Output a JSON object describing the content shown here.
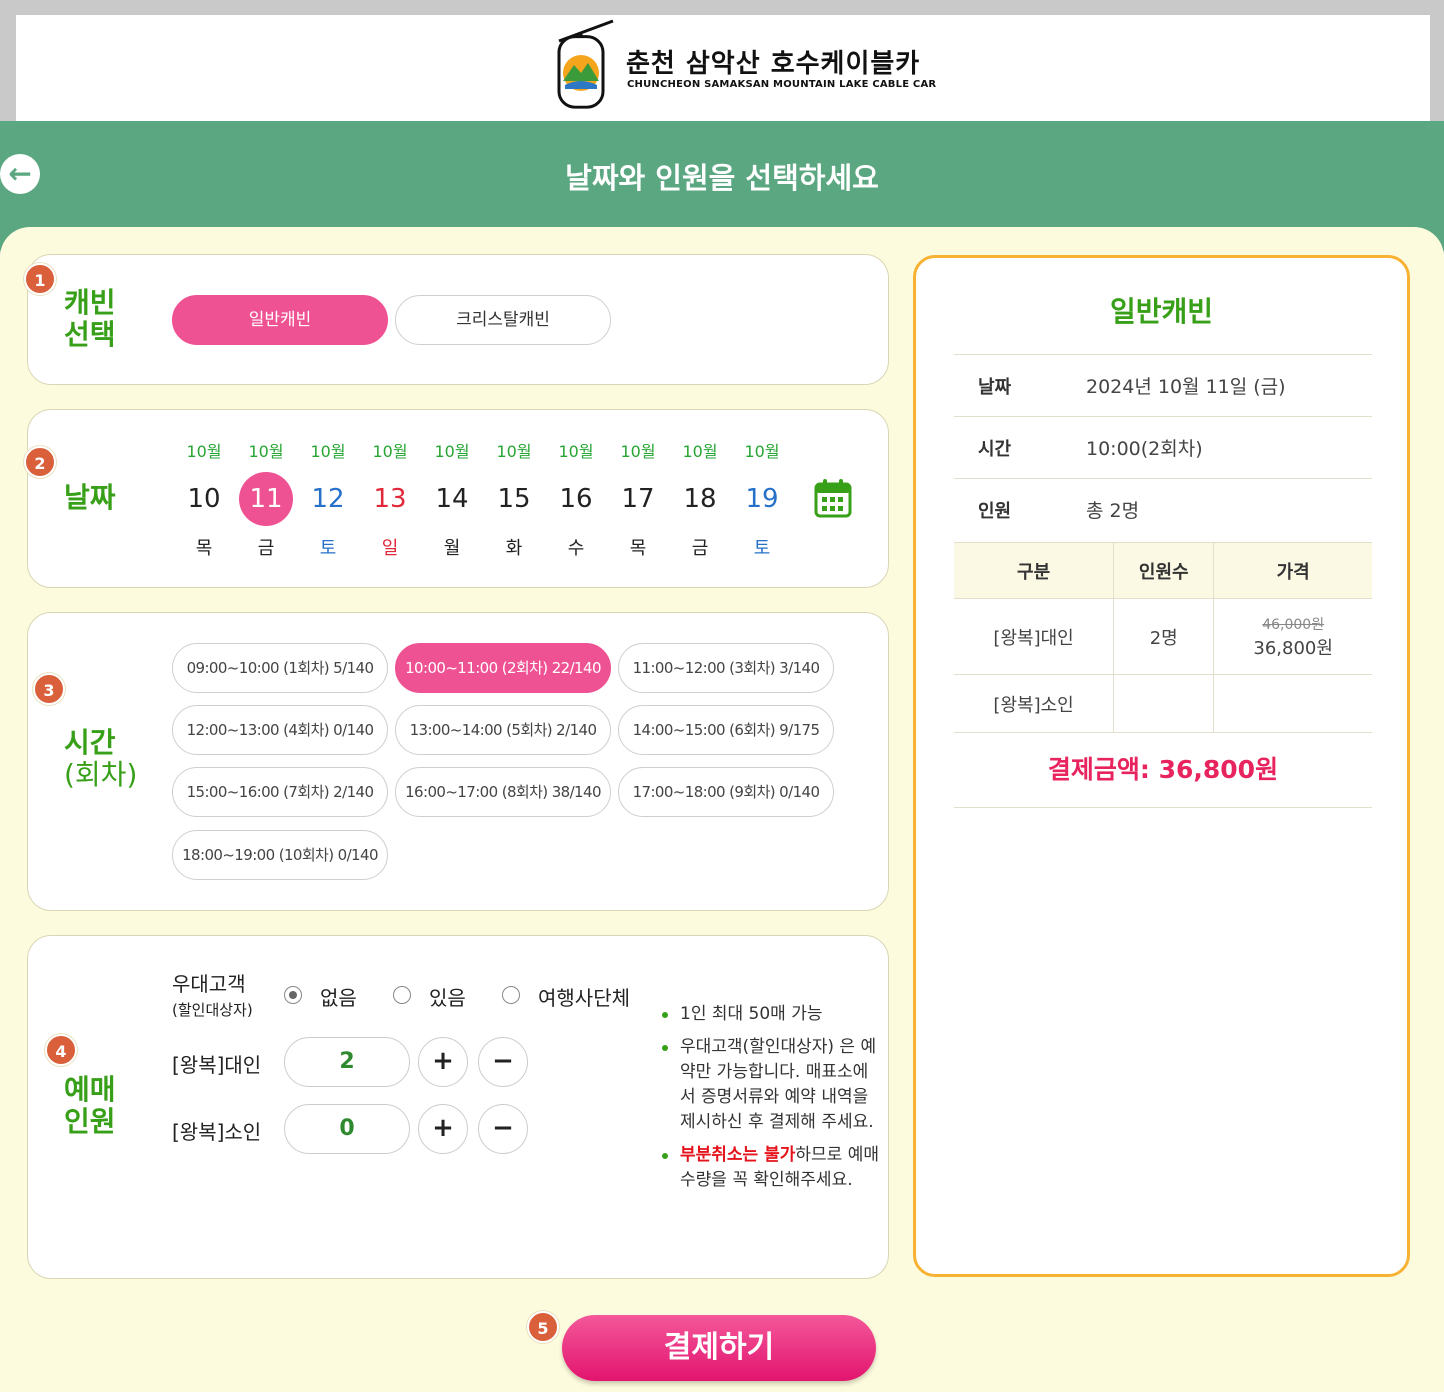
{
  "header": {
    "logo_ko": "춘천 삼악산 호수케이블카",
    "logo_en": "CHUNCHEON SAMAKSAN MOUNTAIN LAKE CABLE CAR"
  },
  "titlebar": {
    "title": "날짜와 인원을 선택하세요",
    "back_icon": "←"
  },
  "steps": [
    "1",
    "2",
    "3",
    "4",
    "5"
  ],
  "cabin": {
    "label_line1": "캐빈",
    "label_line2": "선택",
    "options": [
      {
        "label": "일반캐빈",
        "selected": true
      },
      {
        "label": "크리스탈캐빈",
        "selected": false
      }
    ]
  },
  "dates": {
    "label": "날짜",
    "items": [
      {
        "month": "10월",
        "day": "10",
        "weekday": "목",
        "color": "default"
      },
      {
        "month": "10월",
        "day": "11",
        "weekday": "금",
        "color": "default",
        "selected": true
      },
      {
        "month": "10월",
        "day": "12",
        "weekday": "토",
        "color": "blue"
      },
      {
        "month": "10월",
        "day": "13",
        "weekday": "일",
        "color": "red"
      },
      {
        "month": "10월",
        "day": "14",
        "weekday": "월",
        "color": "default"
      },
      {
        "month": "10월",
        "day": "15",
        "weekday": "화",
        "color": "default"
      },
      {
        "month": "10월",
        "day": "16",
        "weekday": "수",
        "color": "default"
      },
      {
        "month": "10월",
        "day": "17",
        "weekday": "목",
        "color": "default"
      },
      {
        "month": "10월",
        "day": "18",
        "weekday": "금",
        "color": "default"
      },
      {
        "month": "10월",
        "day": "19",
        "weekday": "토",
        "color": "blue"
      }
    ],
    "calendar_icon": "calendar-icon"
  },
  "time": {
    "label_line1": "시간",
    "label_line2": "(회차)",
    "slots": [
      {
        "label": "09:00~10:00 (1회차) 5/140"
      },
      {
        "label": "10:00~11:00 (2회차) 22/140",
        "selected": true
      },
      {
        "label": "11:00~12:00 (3회차) 3/140"
      },
      {
        "label": "12:00~13:00 (4회차) 0/140"
      },
      {
        "label": "13:00~14:00 (5회차) 2/140"
      },
      {
        "label": "14:00~15:00 (6회차) 9/175"
      },
      {
        "label": "15:00~16:00 (7회차) 2/140"
      },
      {
        "label": "16:00~17:00 (8회차) 38/140"
      },
      {
        "label": "17:00~18:00 (9회차) 0/140"
      },
      {
        "label": "18:00~19:00 (10회차) 0/140"
      }
    ]
  },
  "people": {
    "label_line1": "예매",
    "label_line2": "인원",
    "preferential_label": "우대고객",
    "preferential_sub": "(할인대상자)",
    "radio_options": [
      {
        "label": "없음",
        "checked": true
      },
      {
        "label": "있음",
        "checked": false
      },
      {
        "label": "여행사단체",
        "checked": false
      }
    ],
    "adult_label": "[왕복]대인",
    "adult_value": "2",
    "child_label": "[왕복]소인",
    "child_value": "0",
    "plus": "+",
    "minus": "−",
    "notes": {
      "n1": "1인 최대 50매 가능",
      "n2": "우대고객(할인대상자) 은 예약만 가능합니다. 매표소에서 증명서류와 예약 내역을 제시하신 후 결제해 주세요.",
      "n3_em": "부분취소는 불가",
      "n3_rest": "하므로 예매수량을 꼭 확인해주세요."
    }
  },
  "summary": {
    "title": "일반캐빈",
    "rows": [
      {
        "key": "날짜",
        "value": "2024년 10월 11일 (금)"
      },
      {
        "key": "시간",
        "value": "10:00(2회차)"
      },
      {
        "key": "인원",
        "value": "총 2명"
      }
    ],
    "table_headers": [
      "구분",
      "인원수",
      "가격"
    ],
    "table_rows": [
      {
        "type": "[왕복]대인",
        "count": "2명",
        "original_price": "46,000원",
        "price": "36,800원"
      },
      {
        "type": "[왕복]소인",
        "count": "",
        "original_price": "",
        "price": ""
      }
    ],
    "total": "결제금액: 36,800원"
  },
  "pay_button": "결제하기"
}
